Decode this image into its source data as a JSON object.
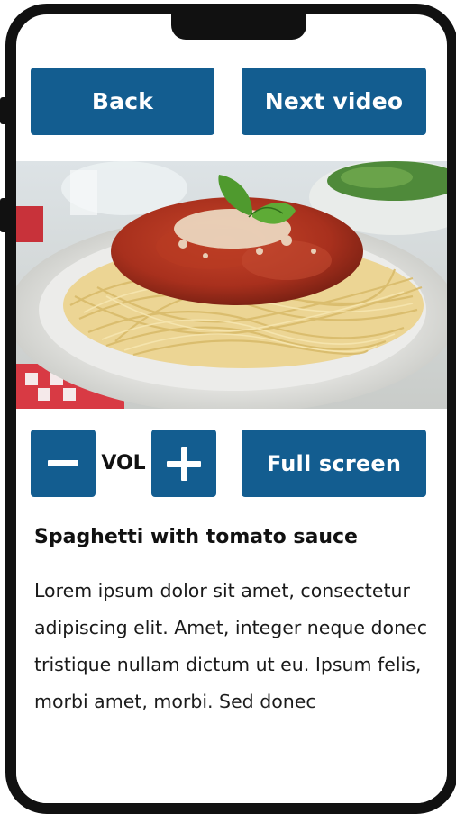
{
  "controls": {
    "back_label": "Back",
    "next_label": "Next video",
    "volume_label": "VOL",
    "fullscreen_label": "Full screen"
  },
  "video": {
    "thumbnail": "plate of spaghetti with tomato meat sauce, parmesan and basil"
  },
  "recipe": {
    "title": "Spaghetti with tomato sauce",
    "body": "Lorem ipsum dolor sit amet, consectetur adipiscing elit. Amet, integer neque donec tristique nullam dictum ut eu. Ipsum felis, morbi amet, morbi. Sed donec"
  },
  "colors": {
    "button": "#135d90",
    "frame": "#111111",
    "text": "#111111"
  }
}
